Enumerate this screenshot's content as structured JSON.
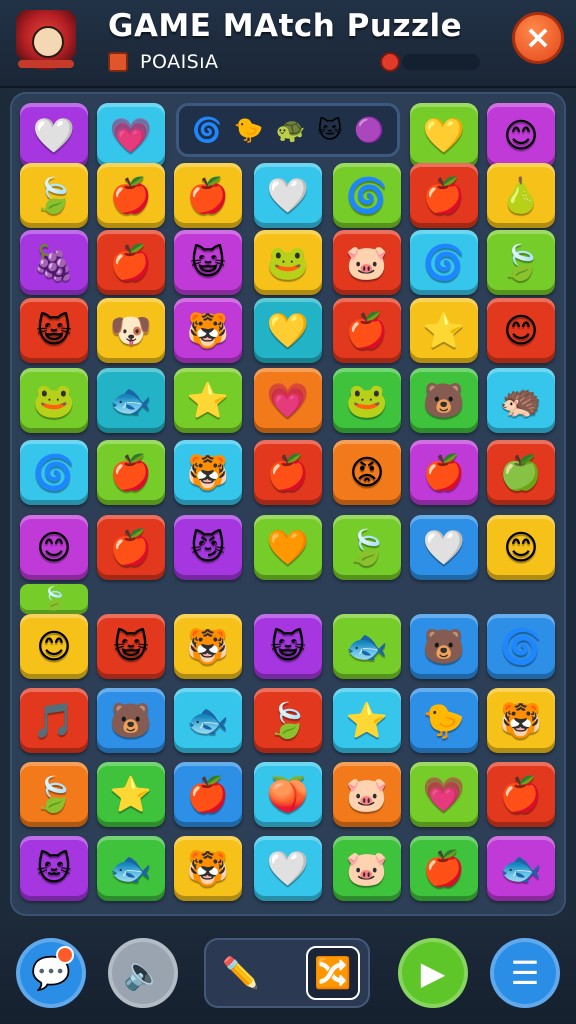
{
  "header": {
    "title": "GAME MAtch Puzzle",
    "subtitle": "POAISıA",
    "close_icon": "×"
  },
  "top_strip": {
    "icons": [
      "🌀",
      "🐤",
      "🐢",
      "🐱",
      "🟣"
    ]
  },
  "board": {
    "rows": 11,
    "cols": 7,
    "colors": {
      "purple": "#a536e0",
      "cyan": "#36c6ec",
      "lime": "#76cc28",
      "yellow": "#f6c21a",
      "red": "#e2381e",
      "orange": "#f27a1a",
      "green": "#3fc23c",
      "blue": "#2d8fe6",
      "magenta": "#c03ad8",
      "pink": "#f04a8e",
      "teal": "#22b4c6"
    },
    "tiles": [
      [
        {
          "c": "purple",
          "i": "🤍"
        },
        {
          "c": "cyan",
          "i": "💗"
        },
        null,
        null,
        null,
        {
          "c": "lime",
          "i": "💛"
        },
        {
          "c": "magenta",
          "i": "😊"
        }
      ],
      [
        {
          "c": "yellow",
          "i": "🍃"
        },
        {
          "c": "yellow",
          "i": "🍎"
        },
        {
          "c": "yellow",
          "i": "🍎"
        },
        {
          "c": "cyan",
          "i": "🤍"
        },
        {
          "c": "lime",
          "i": "🌀"
        },
        {
          "c": "red",
          "i": "🍎"
        },
        {
          "c": "yellow",
          "i": "🍐"
        }
      ],
      [
        {
          "c": "purple",
          "i": "🍇"
        },
        {
          "c": "red",
          "i": "🍎"
        },
        {
          "c": "magenta",
          "i": "😺"
        },
        {
          "c": "yellow",
          "i": "🐸"
        },
        {
          "c": "red",
          "i": "🐷"
        },
        {
          "c": "cyan",
          "i": "🌀"
        },
        {
          "c": "lime",
          "i": "🍃"
        }
      ],
      [
        {
          "c": "red",
          "i": "😺"
        },
        {
          "c": "yellow",
          "i": "🐶"
        },
        {
          "c": "magenta",
          "i": "🐯"
        },
        {
          "c": "teal",
          "i": "💛"
        },
        {
          "c": "red",
          "i": "🍎"
        },
        {
          "c": "yellow",
          "i": "⭐"
        },
        {
          "c": "red",
          "i": "😊"
        }
      ],
      [
        {
          "c": "lime",
          "i": "🐸"
        },
        {
          "c": "teal",
          "i": "🐟"
        },
        {
          "c": "lime",
          "i": "⭐"
        },
        {
          "c": "orange",
          "i": "💗"
        },
        {
          "c": "green",
          "i": "🐸"
        },
        {
          "c": "green",
          "i": "🐻"
        },
        {
          "c": "cyan",
          "i": "🦔"
        }
      ],
      [
        {
          "c": "cyan",
          "i": "🌀"
        },
        {
          "c": "lime",
          "i": "🍎"
        },
        {
          "c": "cyan",
          "i": "🐯"
        },
        {
          "c": "red",
          "i": "🍎"
        },
        {
          "c": "orange",
          "i": "😡"
        },
        {
          "c": "magenta",
          "i": "🍎"
        },
        {
          "c": "red",
          "i": "🍏"
        }
      ],
      [
        {
          "c": "magenta",
          "i": "😊"
        },
        {
          "c": "red",
          "i": "🍎"
        },
        {
          "c": "purple",
          "i": "😼"
        },
        {
          "c": "lime",
          "i": "🧡"
        },
        {
          "c": "lime",
          "i": "🍃"
        },
        {
          "c": "blue",
          "i": "🤍"
        },
        {
          "c": "yellow",
          "i": "😊"
        }
      ],
      [
        {
          "c": "yellow",
          "i": "😊"
        },
        {
          "c": "red",
          "i": "😺"
        },
        {
          "c": "yellow",
          "i": "🐯"
        },
        {
          "c": "purple",
          "i": "😺"
        },
        {
          "c": "lime",
          "i": "🐟"
        },
        {
          "c": "blue",
          "i": "🐻"
        },
        {
          "c": "blue",
          "i": "🌀"
        }
      ],
      [
        {
          "c": "red",
          "i": "🎵"
        },
        {
          "c": "blue",
          "i": "🐻"
        },
        {
          "c": "cyan",
          "i": "🐟"
        },
        {
          "c": "red",
          "i": "🍃"
        },
        {
          "c": "cyan",
          "i": "⭐"
        },
        {
          "c": "blue",
          "i": "🐤"
        },
        {
          "c": "yellow",
          "i": "🐯"
        }
      ],
      [
        {
          "c": "orange",
          "i": "🍃"
        },
        {
          "c": "green",
          "i": "⭐"
        },
        {
          "c": "blue",
          "i": "🍎"
        },
        {
          "c": "cyan",
          "i": "🍑"
        },
        {
          "c": "orange",
          "i": "🐷"
        },
        {
          "c": "lime",
          "i": "💗"
        },
        {
          "c": "red",
          "i": "🍎"
        }
      ],
      [
        {
          "c": "purple",
          "i": "🐱"
        },
        {
          "c": "green",
          "i": "🐟"
        },
        {
          "c": "yellow",
          "i": "🐯"
        },
        {
          "c": "cyan",
          "i": "🤍"
        },
        {
          "c": "green",
          "i": "🐷"
        },
        {
          "c": "green",
          "i": "🍎"
        },
        {
          "c": "magenta",
          "i": "🐟"
        }
      ]
    ],
    "partial_tile": {
      "c": "lime",
      "i": "🍃"
    }
  },
  "bottom": {
    "chat_icon": "💬",
    "sound_icon": "🔈",
    "pencil_icon": "✏️",
    "shuffle_icon": "🔀",
    "play_icon": "▶",
    "menu_icon": "☰",
    "colors": {
      "chat": "#2a8de6",
      "sound": "#9aa4b0",
      "play": "#5fc62a",
      "menu": "#2a8de6"
    }
  }
}
